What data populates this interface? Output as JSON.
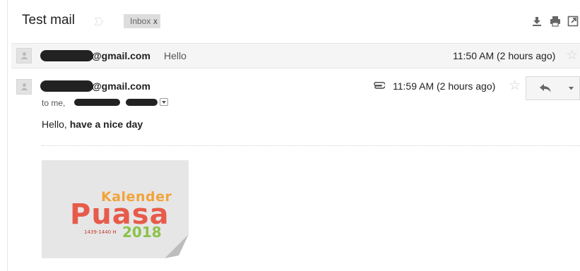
{
  "thread": {
    "subject": "Test mail",
    "label": {
      "name": "Inbox",
      "remove": "x"
    }
  },
  "header_icons": [
    "download-icon",
    "print-icon",
    "new-window-icon"
  ],
  "messages": [
    {
      "state": "collapsed",
      "sender_domain": "@gmail.com",
      "snippet": "Hello",
      "time": "11:50 AM (2 hours ago)",
      "starred": false
    },
    {
      "state": "expanded",
      "sender_domain": "@gmail.com",
      "has_attachment": true,
      "time": "11:59 AM (2 hours ago)",
      "starred": false,
      "to_prefix": "to me,",
      "body_plain": "Hello,",
      "body_bold": "have a nice day",
      "attachment": {
        "line1": "Kalender",
        "line2": "Puasa",
        "dates": "1439-1440 H",
        "year": "2018"
      }
    }
  ],
  "colors": {
    "collapsed_bg": "#f5f5f5",
    "label_bg": "#dddddd",
    "thumb_orange": "#f2a33a",
    "thumb_red": "#e75b4a",
    "thumb_green": "#8bc34a"
  }
}
